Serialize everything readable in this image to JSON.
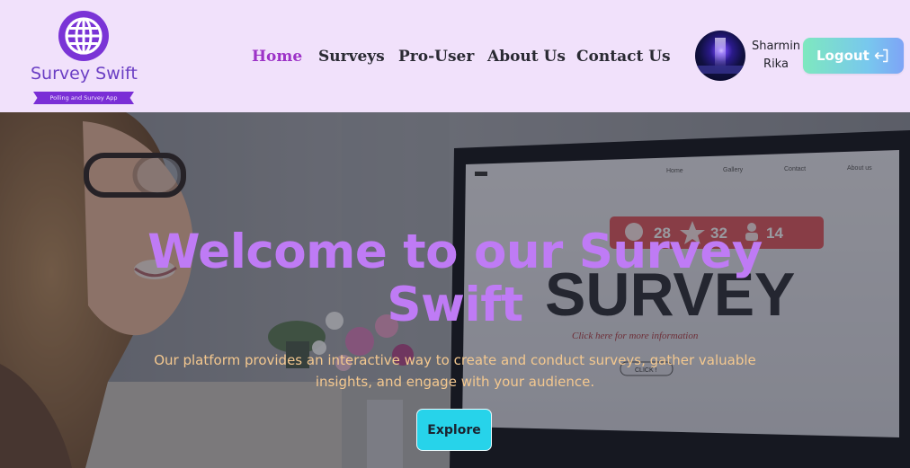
{
  "brand": {
    "name": "Survey Swift",
    "tagline": "Polling and Survey App",
    "logo_icon": "globe-icon"
  },
  "nav": {
    "items": [
      {
        "label": "Home",
        "active": true
      },
      {
        "label": "Surveys",
        "active": false
      },
      {
        "label": "Pro-User",
        "active": false
      },
      {
        "label": "About Us",
        "active": false
      },
      {
        "label": "Contact Us",
        "active": false
      }
    ],
    "active_color": "#9d33c7"
  },
  "user": {
    "first_name": "Sharmin",
    "last_name": "Rika"
  },
  "logout": {
    "label": "Logout",
    "icon": "logout-icon"
  },
  "hero": {
    "title": "Welcome to our Survey Swift",
    "subtitle": "Our platform provides an interactive way to create and conduct surveys, gather valuable insights, and engage with your audience.",
    "button_label": "Explore"
  },
  "background_screen": {
    "nav": [
      "Home",
      "Gallery",
      "Contact",
      "About us"
    ],
    "counters": [
      "28",
      "32",
      "14"
    ],
    "headline": "SURVEY",
    "tagline": "Click here for more information",
    "button": "CLICK !"
  },
  "colors": {
    "navbar_bg": "#f1e1fb",
    "hero_title": "#bf7bf5",
    "hero_subtitle": "#f4c88f",
    "explore_button": "#27d3ea",
    "logout_gradient_start": "#7ee8bf",
    "logout_gradient_end": "#7ea4f6"
  }
}
